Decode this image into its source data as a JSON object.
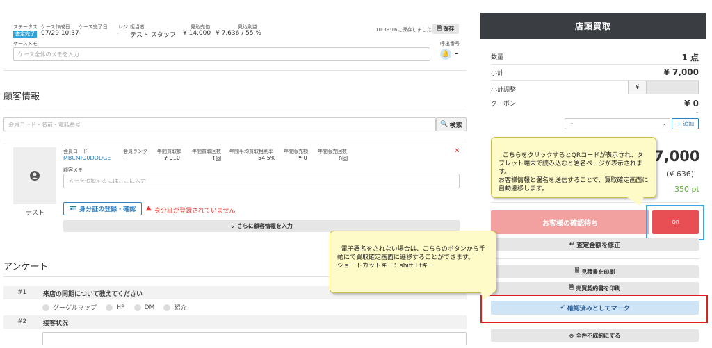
{
  "header_row": {
    "labels": [
      "ステータス",
      "ケース作成日",
      "ケース完了日",
      "レジ",
      "担当者",
      "見込売価",
      "見込利益"
    ],
    "status_badge": "査定完了",
    "created": "07/29 10:37",
    "completed": "-",
    "register": "-",
    "staff": "テスト スタッフ",
    "expected_price": "¥ 14,000",
    "expected_profit": "¥ 7,636 / 55 %",
    "saved_text": "10:39:16に保存しました",
    "save_button": "保存",
    "memo_label": "ケースメモ",
    "memo_placeholder": "ケース全体のメモを入力",
    "call_label": "呼出番号",
    "call_value": "–"
  },
  "customer": {
    "section_title": "顧客情報",
    "search_placeholder": "会員コード・名前・電話番号",
    "search_button": "検索",
    "col_labels": [
      "会員コード",
      "会員ランク",
      "年間買取額",
      "年間買取回数",
      "年間平均買取粗利率",
      "年間販売額",
      "年間販売回数"
    ],
    "member_code": "MBCMIQ0DODGE",
    "rank": "-",
    "annual_purchase": "¥ 910",
    "annual_count": "1回",
    "avg_margin": "54.5%",
    "annual_sales": "¥ 0",
    "sales_count": "0回",
    "memo_label": "顧客メモ",
    "memo_placeholder": "メモを追加するにはここに入力",
    "name": "テスト",
    "id_button": "身分証の登録・確認",
    "id_warning": "身分証が登録されていません",
    "more_button": "さらに顧客情報を入力"
  },
  "survey": {
    "section_title": "アンケート",
    "q1_num": "#1",
    "q1_text": "来店の同期について教えてください",
    "q1_options": [
      "グーグルマップ",
      "HP",
      "DM",
      "紹介"
    ],
    "q2_num": "#2",
    "q2_text": "接客状況"
  },
  "panel": {
    "title": "店頭買取",
    "qty_label": "数量",
    "qty_value": "1 点",
    "subtotal_label": "小計",
    "subtotal_value": "¥ 7,000",
    "adjust_label": "小計調整",
    "adjust_currency": "¥",
    "coupon_label": "クーポン",
    "coupon_value": "¥ 0",
    "coupon_dash": "-",
    "coupon_select": "-",
    "add_button": "+ 追加",
    "total_partial": "7,000",
    "tax_partial": "(¥ 636)",
    "points": "350 pt",
    "waiting_button": "お客様の確認待ち",
    "qr_button": "QR",
    "fix_button": "査定金額を修正",
    "estimate_button": "見積書を印刷",
    "contract_button": "売買契約書を印刷",
    "confirm_button": "確認済みとしてマーク",
    "cancel_button": "全件不成約にする"
  },
  "callouts": {
    "top": "こちらをクリックするとQRコードが表示され、タブレット端末で読み込むと署名ページが表示されます。\nお客様情報と署名を送信することで、買取確定画面に自動遷移します。",
    "bottom": "電子署名をされない場合は、こちらのボタンから手動にて買取確定画面に遷移することができます。\nショートカットキー：shift＋fキー"
  },
  "colors": {
    "panel_header": "#3a3d42",
    "badge": "#2fa4d9",
    "waiting": "#f2a0a0",
    "qr": "#e84f55",
    "confirm": "#cfe4f5",
    "link": "#2f7fc1",
    "warn": "#e0403d",
    "points": "#5aa832",
    "highlight_red": "#e02020",
    "highlight_blue": "#3aa7e6"
  }
}
